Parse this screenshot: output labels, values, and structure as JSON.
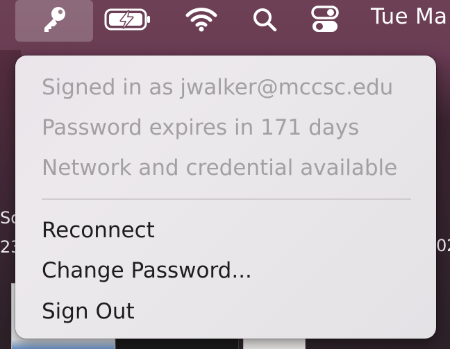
{
  "menubar": {
    "clock": "Tue Ma",
    "icons": [
      "key-icon",
      "battery-charging-icon",
      "wifi-icon",
      "search-icon",
      "control-center-icon"
    ]
  },
  "desktop": {
    "fragments": [
      "So",
      "23",
      "02"
    ]
  },
  "menu": {
    "info": {
      "signed_in": "Signed in as jwalker@mccsc.edu",
      "password_expiry": "Password expires in 171 days",
      "status": "Network and credential available"
    },
    "actions": {
      "reconnect": "Reconnect",
      "change_password": "Change Password...",
      "sign_out": "Sign Out"
    }
  },
  "colors": {
    "menubar": "#6b3f55",
    "menu_bg": "#ebe8eb",
    "info_text": "#a3a0a3",
    "action_text": "#1d1d1f"
  }
}
